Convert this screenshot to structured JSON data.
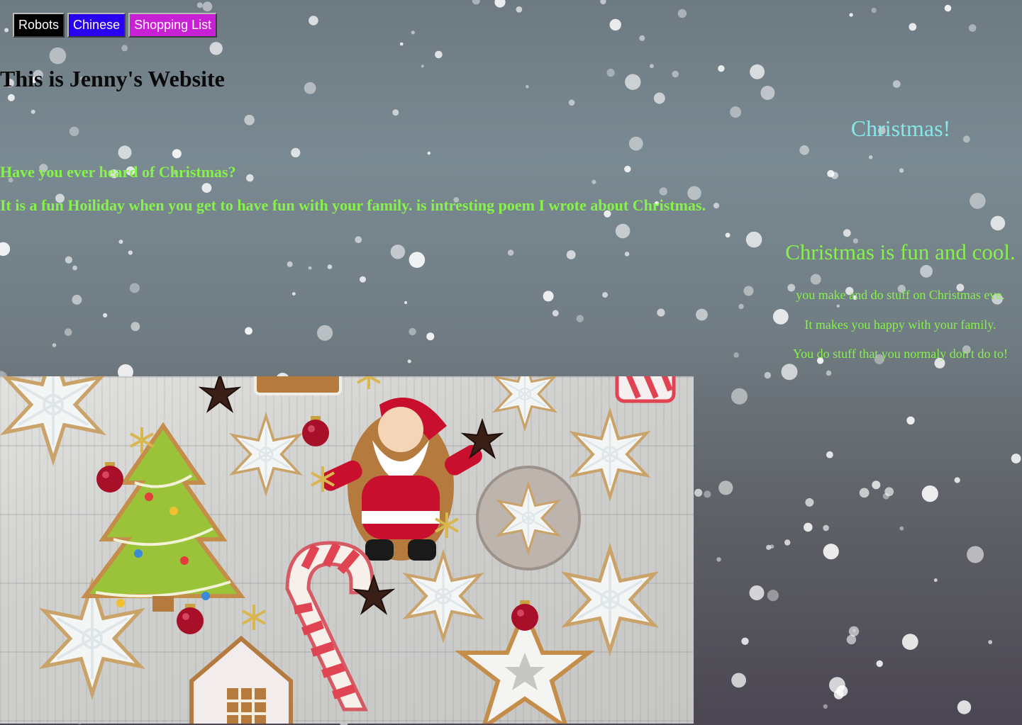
{
  "nav": {
    "items": [
      {
        "label": "Robots",
        "color": "#000000"
      },
      {
        "label": "Chinese",
        "color": "#2a00f0"
      },
      {
        "label": "Shopping List",
        "color": "#c820d4"
      }
    ]
  },
  "page": {
    "title": "This is Jenny's Website"
  },
  "christmas": {
    "heading": "Christmas!",
    "question": "Have you ever heard of Christmas?",
    "description": "It is a fun Hoiliday when you get to have fun with your family. is intresting poem I wrote about Christmas."
  },
  "poem": {
    "title": "Christmas is fun and cool.",
    "lines": [
      "you make and do stuff on Christmas eve.",
      "It makes you happy with your family.",
      "You do stuff that you normaly don't do to!"
    ]
  },
  "colors": {
    "heading_cyan": "#86e6e8",
    "text_green": "#86f24a",
    "title_black": "#0a0a0a"
  }
}
